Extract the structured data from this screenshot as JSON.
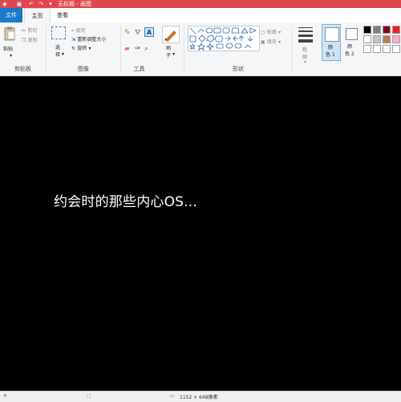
{
  "titlebar": {
    "title": "无标题 - 画图"
  },
  "tabs": {
    "file": "文件",
    "home": "主页",
    "view": "查看"
  },
  "clipboard": {
    "paste": "粘贴",
    "cut": "剪切",
    "copy": "复制",
    "label": "剪贴板"
  },
  "image": {
    "select_top": "选",
    "select_bottom": "择",
    "crop": "裁剪",
    "resize": "重新调整大小",
    "rotate": "旋转",
    "label": "图像"
  },
  "tools": {
    "label": "工具"
  },
  "brushes": {
    "label_top": "刷",
    "label_bottom": "子"
  },
  "shapes": {
    "outline": "轮廓",
    "fill": "填充",
    "label": "形状"
  },
  "size": {
    "label_top": "粗",
    "label_bottom": "细"
  },
  "colors": {
    "color1_top": "颜",
    "color1_bottom": "色 1",
    "color2_top": "颜",
    "color2_bottom": "色 2",
    "palette_row1": [
      "#000000",
      "#7f7f7f",
      "#880015",
      "#ed1c24"
    ],
    "palette_row2": [
      "#ffffff",
      "#c3c3c3",
      "#b97a57",
      "#ffaec9"
    ],
    "palette_row3": [
      "#ffffff",
      "#ffffff",
      "#ffffff",
      "#ffffff"
    ],
    "color1": "#000000",
    "color2": "#ffffff",
    "titlebar_color": "#e0464d",
    "file_tab_color": "#1979ca"
  },
  "canvas": {
    "text": "约会时的那些内心OS..."
  },
  "status": {
    "dimensions": "1152 × 648像素"
  }
}
